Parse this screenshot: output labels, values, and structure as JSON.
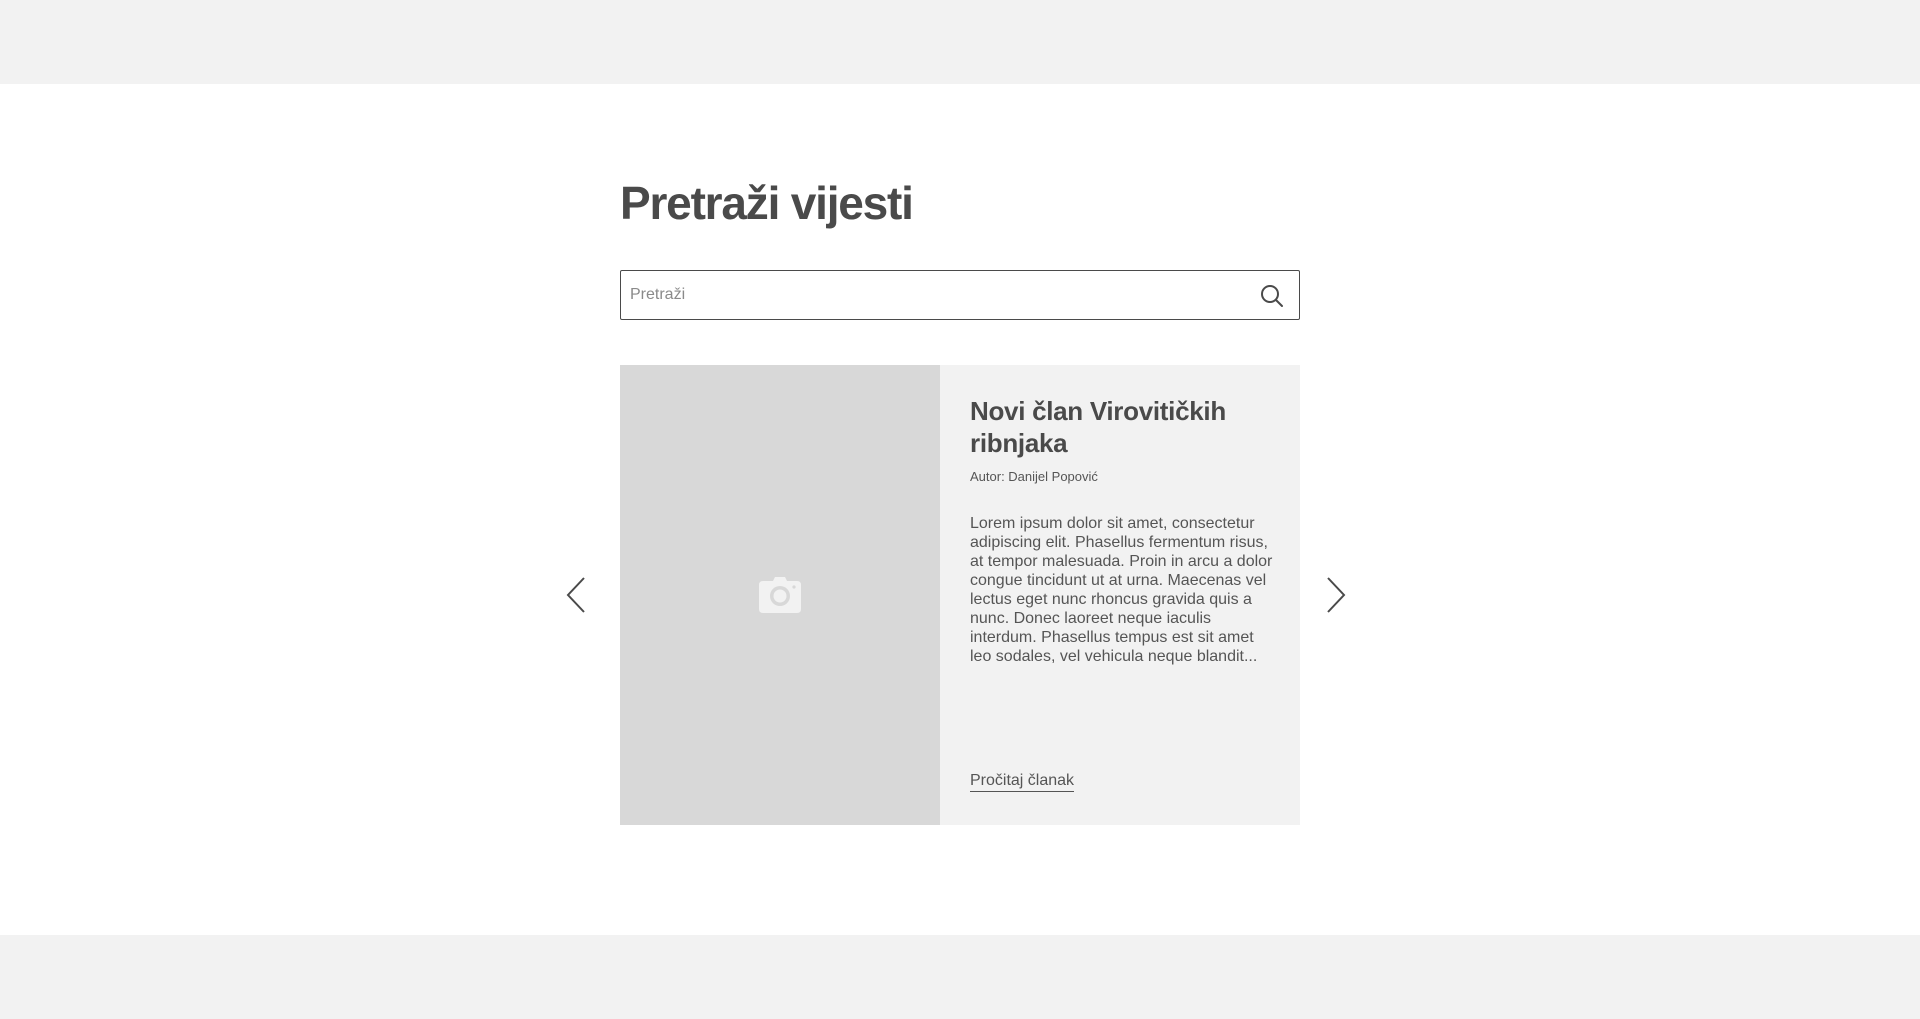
{
  "page": {
    "title": "Pretraži vijesti"
  },
  "search": {
    "placeholder": "Pretraži",
    "value": "",
    "icon": "search-icon"
  },
  "carousel": {
    "prev_icon": "chevron-left-icon",
    "next_icon": "chevron-right-icon",
    "article": {
      "image_icon": "camera-icon",
      "title": "Novi član Virovitičkih ribnjaka",
      "author": "Autor: Danijel Popović",
      "excerpt": "Lorem ipsum dolor sit amet, consectetur adipiscing elit. Phasellus fermentum risus, at tempor malesuada. Proin in arcu a dolor congue tincidunt ut at urna. Maecenas vel lectus eget nunc rhoncus gravida quis a nunc. Donec laoreet neque iaculis interdum. Phasellus tempus est sit amet leo sodales, vel vehicula neque blandit...",
      "read_more_label": "Pročitaj članak"
    }
  },
  "colors": {
    "band_background": "#f2f2f2",
    "image_placeholder": "#d8d8d8",
    "text": "#4a4a4a"
  }
}
